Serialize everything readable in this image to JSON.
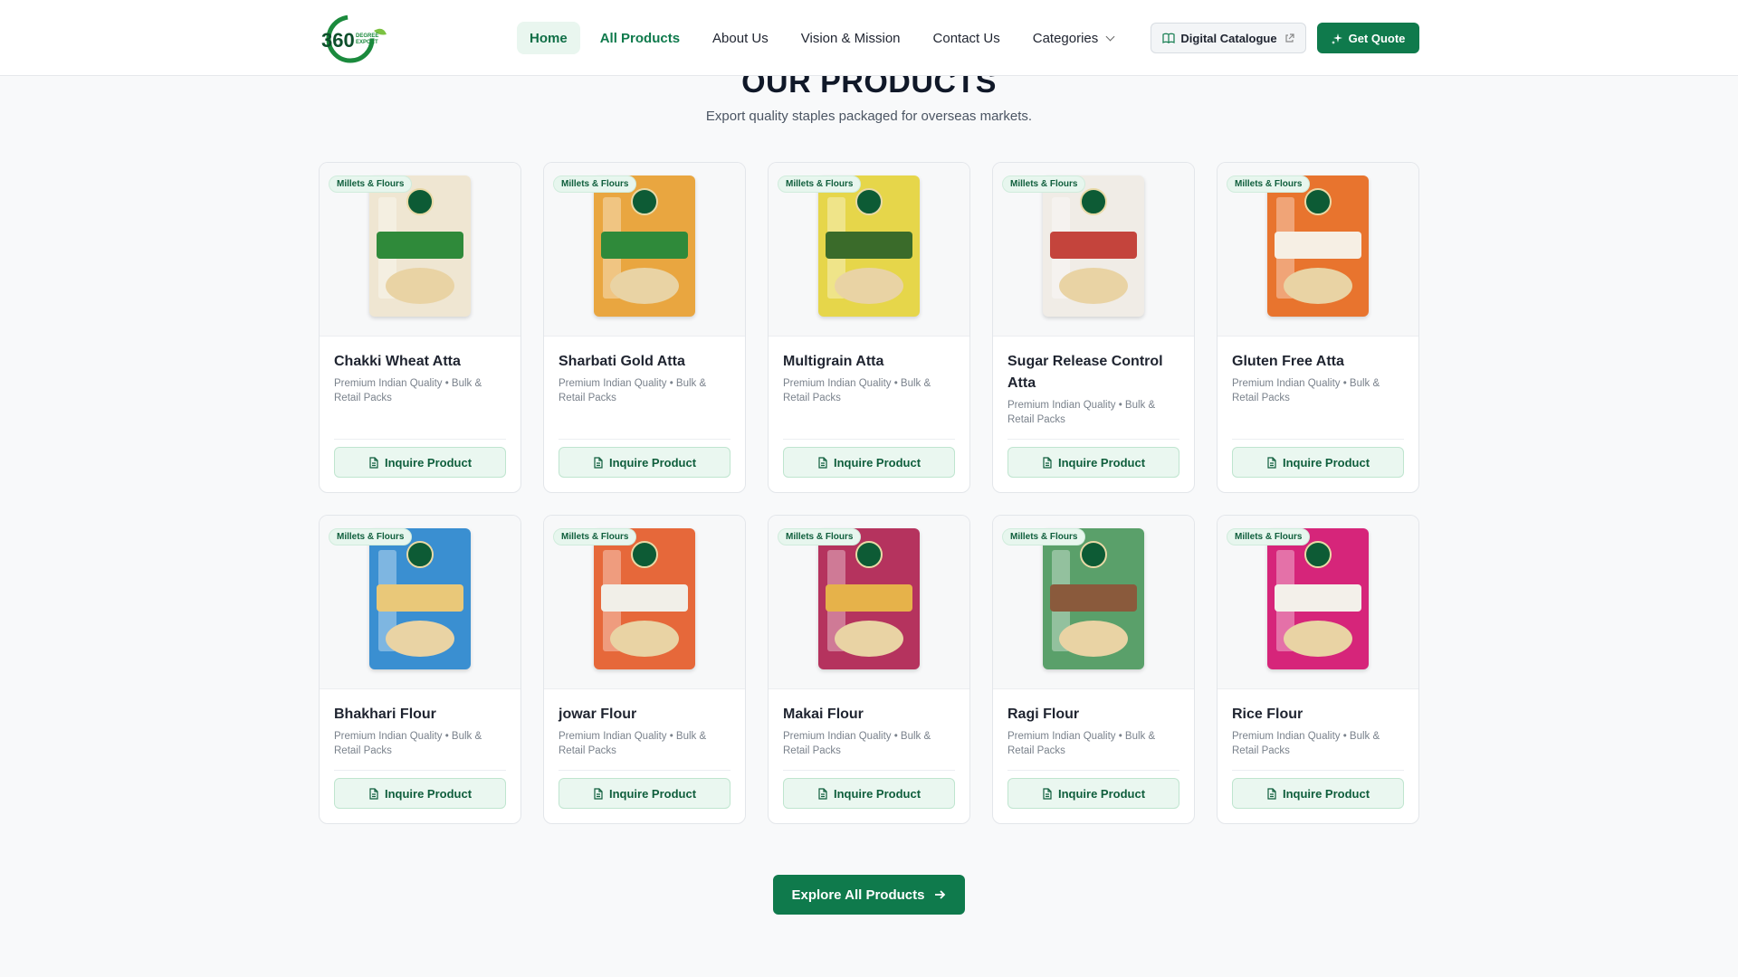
{
  "header": {
    "logo_text": "360",
    "logo_sub": "DEGREE EXPORT",
    "nav": [
      {
        "label": "Home",
        "state": "active"
      },
      {
        "label": "All Products",
        "state": "highlight"
      },
      {
        "label": "About Us",
        "state": "normal"
      },
      {
        "label": "Vision & Mission",
        "state": "normal"
      },
      {
        "label": "Contact Us",
        "state": "normal"
      },
      {
        "label": "Categories",
        "state": "dropdown"
      }
    ],
    "catalogue_label": "Digital Catalogue",
    "quote_label": "Get Quote"
  },
  "section": {
    "title": "OUR PRODUCTS",
    "subtitle": "Export quality staples packaged for overseas markets."
  },
  "products": [
    {
      "tag": "Millets & Flours",
      "name": "Chakki Wheat Atta",
      "desc": "Premium Indian Quality • Bulk & Retail Packs",
      "cta": "Inquire Product",
      "pack_color": "#efe6d2",
      "band_color": "#2f8a3a"
    },
    {
      "tag": "Millets & Flours",
      "name": "Sharbati Gold Atta",
      "desc": "Premium Indian Quality • Bulk & Retail Packs",
      "cta": "Inquire Product",
      "pack_color": "#e9a640",
      "band_color": "#2f8a3a"
    },
    {
      "tag": "Millets & Flours",
      "name": "Multigrain Atta",
      "desc": "Premium Indian Quality • Bulk & Retail Packs",
      "cta": "Inquire Product",
      "pack_color": "#e6d64a",
      "band_color": "#3a6b2a"
    },
    {
      "tag": "Millets & Flours",
      "name": "Sugar Release Control Atta",
      "desc": "Premium Indian Quality • Bulk & Retail Packs",
      "cta": "Inquire Product",
      "pack_color": "#f0ece6",
      "band_color": "#c4443c"
    },
    {
      "tag": "Millets & Flours",
      "name": "Gluten Free Atta",
      "desc": "Premium Indian Quality • Bulk & Retail Packs",
      "cta": "Inquire Product",
      "pack_color": "#e8742e",
      "band_color": "#f6efe4"
    },
    {
      "tag": "Millets & Flours",
      "name": "Bhakhari Flour",
      "desc": "Premium Indian Quality • Bulk & Retail Packs",
      "cta": "Inquire Product",
      "pack_color": "#3a8fd1",
      "band_color": "#e9c879"
    },
    {
      "tag": "Millets & Flours",
      "name": "jowar Flour",
      "desc": "Premium Indian Quality • Bulk & Retail Packs",
      "cta": "Inquire Product",
      "pack_color": "#e6683a",
      "band_color": "#f1efe8"
    },
    {
      "tag": "Millets & Flours",
      "name": "Makai Flour",
      "desc": "Premium Indian Quality • Bulk & Retail Packs",
      "cta": "Inquire Product",
      "pack_color": "#b5335e",
      "band_color": "#e6b24a"
    },
    {
      "tag": "Millets & Flours",
      "name": "Ragi Flour",
      "desc": "Premium Indian Quality • Bulk & Retail Packs",
      "cta": "Inquire Product",
      "pack_color": "#5aa06a",
      "band_color": "#8a5a3c"
    },
    {
      "tag": "Millets & Flours",
      "name": "Rice Flour",
      "desc": "Premium Indian Quality • Bulk & Retail Packs",
      "cta": "Inquire Product",
      "pack_color": "#d6257a",
      "band_color": "#f3f0ea"
    }
  ],
  "explore_label": "Explore All Products",
  "colors": {
    "brand": "#0f7a4c",
    "accent_light": "#eaf7f0"
  }
}
